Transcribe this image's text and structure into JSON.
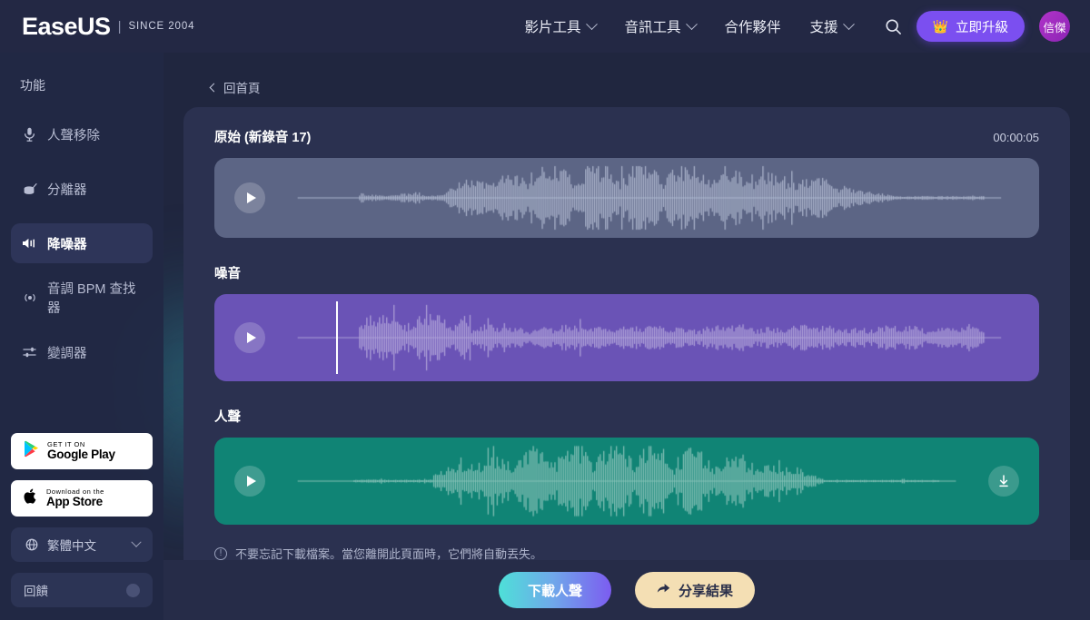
{
  "brand": {
    "name": "EaseUS",
    "separator": "|",
    "since": "SINCE 2004"
  },
  "topnav": {
    "items": [
      {
        "label": "影片工具",
        "has_dropdown": true,
        "icon": "chevron-down-icon"
      },
      {
        "label": "音訊工具",
        "has_dropdown": true,
        "icon": "chevron-down-icon"
      },
      {
        "label": "合作夥伴",
        "has_dropdown": false,
        "icon": ""
      },
      {
        "label": "支援",
        "has_dropdown": true,
        "icon": "chevron-down-icon"
      }
    ],
    "search_icon": "search-icon",
    "upgrade": {
      "label": "立即升級",
      "icon": "crown-icon",
      "color": "#7b4ff0"
    },
    "avatar": {
      "initials": "信傑",
      "color": "#a52ec0"
    }
  },
  "sidebar": {
    "section_title": "功能",
    "items": [
      {
        "label": "人聲移除",
        "icon": "microphone-icon",
        "active": false
      },
      {
        "label": "分離器",
        "icon": "drum-icon",
        "active": false
      },
      {
        "label": "降噪器",
        "icon": "speaker-wave-icon",
        "active": true
      },
      {
        "label": "音調 BPM 查找器",
        "icon": "pulse-icon",
        "active": false
      },
      {
        "label": "變調器",
        "icon": "sliders-icon",
        "active": false
      }
    ],
    "stores": [
      {
        "top": "GET IT ON",
        "bottom": "Google Play",
        "icon": "google-play-icon"
      },
      {
        "top": "Download on the",
        "bottom": "App Store",
        "icon": "apple-icon"
      }
    ],
    "language": {
      "label": "繁體中文",
      "icon": "globe-icon",
      "chevron": "chevron-down-icon"
    },
    "feedback": {
      "label": "回饋",
      "icon": "feedback-dot-icon"
    }
  },
  "main": {
    "breadcrumb": {
      "label": "回首頁",
      "icon": "chevron-left-icon"
    },
    "tracks": [
      {
        "title": "原始 (新錄音 17)",
        "duration": "00:00:05",
        "kind": "original",
        "color": "#5c6585",
        "wave_color": "#a9b1c9",
        "has_download": false,
        "playhead_pct": null,
        "play_icon": "play-icon"
      },
      {
        "title": "噪音",
        "duration": "",
        "kind": "noise",
        "color": "#6a53b6",
        "wave_color": "#a99ad6",
        "has_download": false,
        "playhead_pct": 5.0,
        "play_icon": "play-icon"
      },
      {
        "title": "人聲",
        "duration": "",
        "kind": "vocal",
        "color": "#108475",
        "wave_color": "#83c0b6",
        "has_download": true,
        "playhead_pct": null,
        "play_icon": "play-icon",
        "download_icon": "download-icon"
      }
    ],
    "notice": {
      "icon": "info-icon",
      "text": "不要忘記下載檔案。當您離開此頁面時，它們將自動丟失。"
    }
  },
  "actions": {
    "download": {
      "label": "下載人聲"
    },
    "share": {
      "label": "分享結果",
      "icon": "share-arrow-icon"
    }
  }
}
